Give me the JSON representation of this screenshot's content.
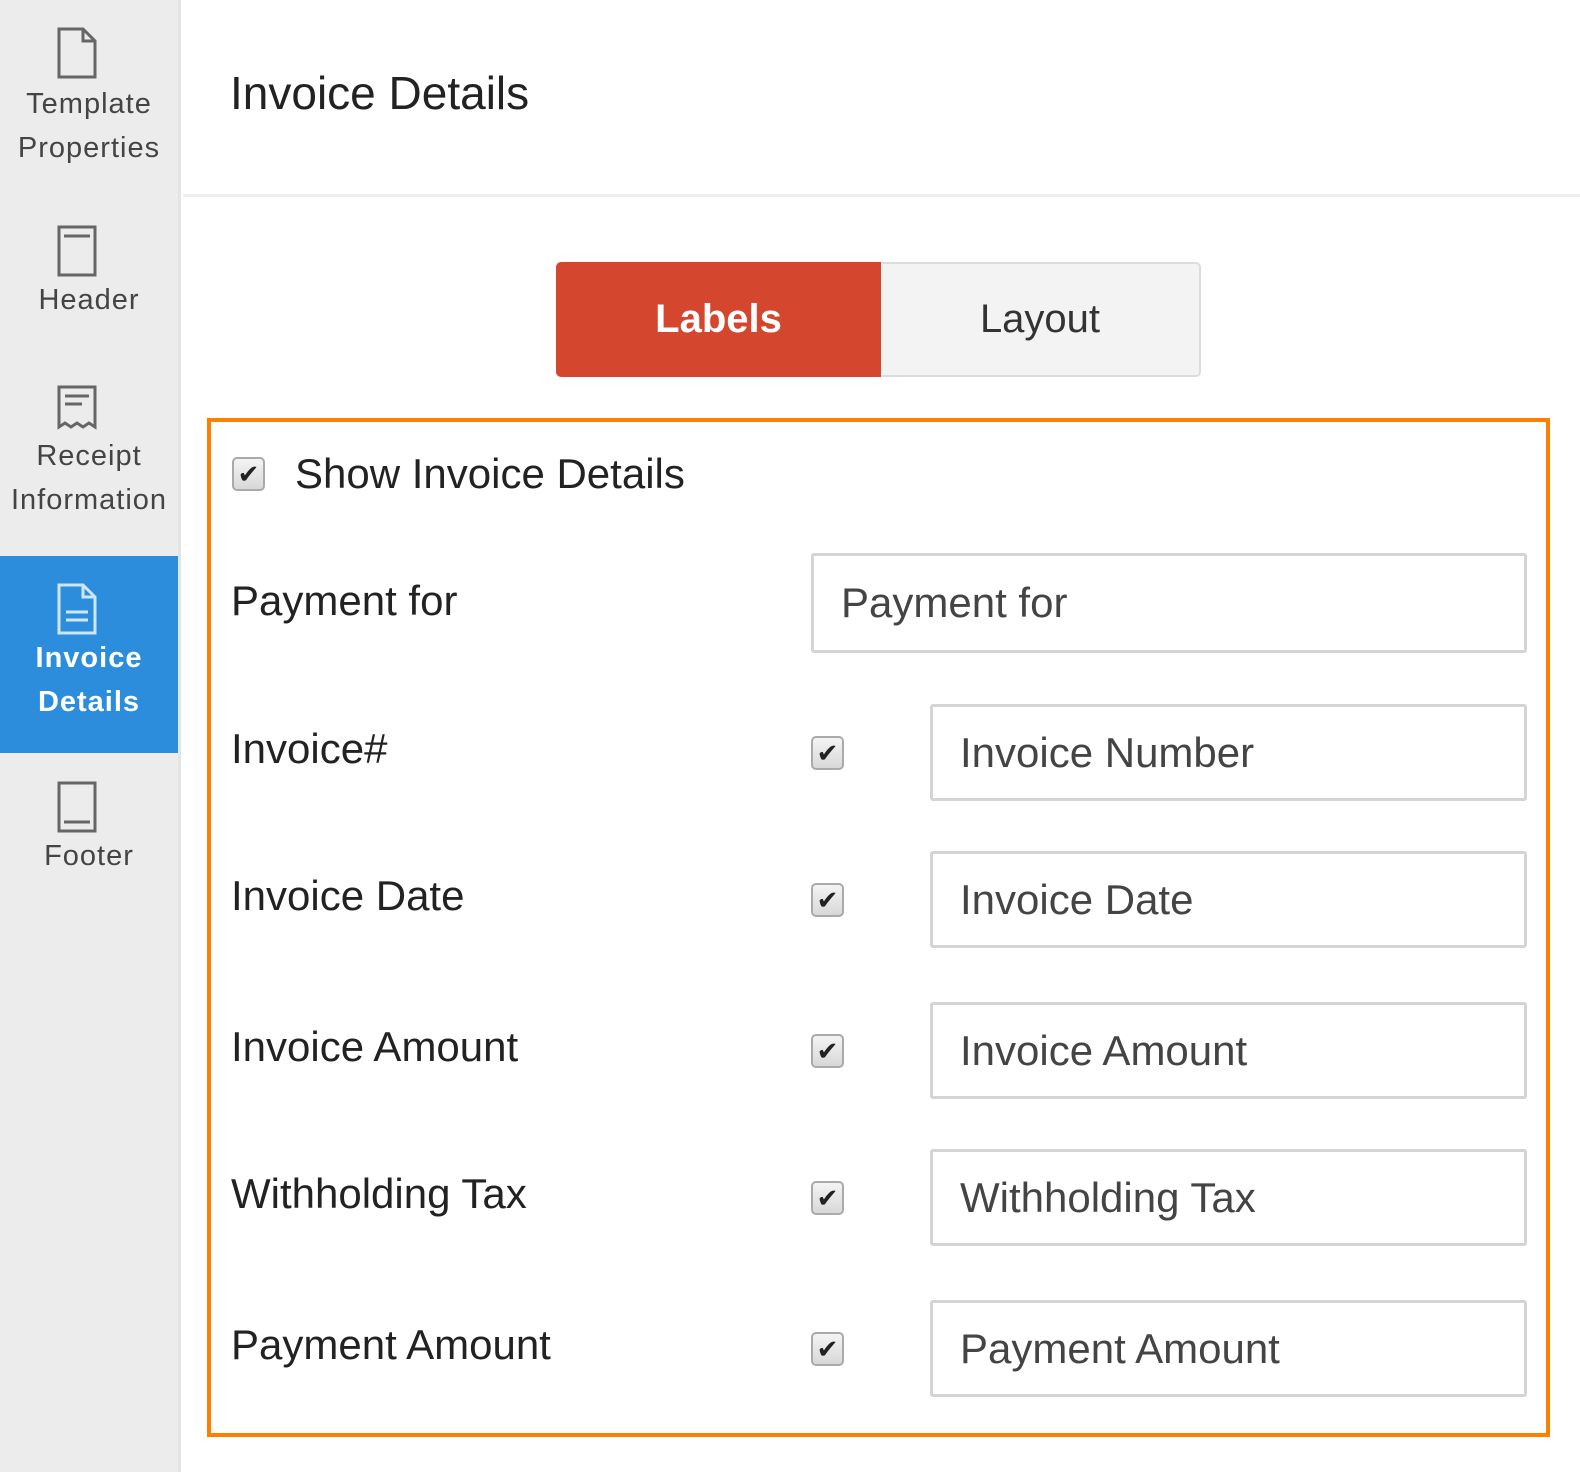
{
  "sidebar": {
    "items": [
      {
        "label1": "Template",
        "label2": "Properties",
        "icon": "document-icon"
      },
      {
        "label1": "Header",
        "icon": "header-icon"
      },
      {
        "label1": "Receipt",
        "label2": "Information",
        "icon": "receipt-icon"
      },
      {
        "label1": "Invoice",
        "label2": "Details",
        "icon": "invoice-icon",
        "active": true
      },
      {
        "label1": "Footer",
        "icon": "footer-icon"
      }
    ]
  },
  "header": {
    "title": "Invoice Details"
  },
  "tabs": [
    {
      "label": "Labels",
      "active": true
    },
    {
      "label": "Layout"
    }
  ],
  "colors": {
    "accent": "#d5462f",
    "active_nav": "#2b8ddb",
    "highlight": "#ff8000"
  },
  "form": {
    "show_label": "Show Invoice Details",
    "show_checked": true,
    "payment_for": {
      "label": "Payment for",
      "value": "Payment for"
    },
    "rows": [
      {
        "label": "Invoice#",
        "checked": true,
        "value": "Invoice Number"
      },
      {
        "label": "Invoice Date",
        "checked": true,
        "value": "Invoice Date"
      },
      {
        "label": "Invoice Amount",
        "checked": true,
        "value": "Invoice Amount"
      },
      {
        "label": "Withholding Tax",
        "checked": true,
        "value": "Withholding Tax"
      },
      {
        "label": "Payment Amount",
        "checked": true,
        "value": "Payment Amount"
      }
    ]
  }
}
